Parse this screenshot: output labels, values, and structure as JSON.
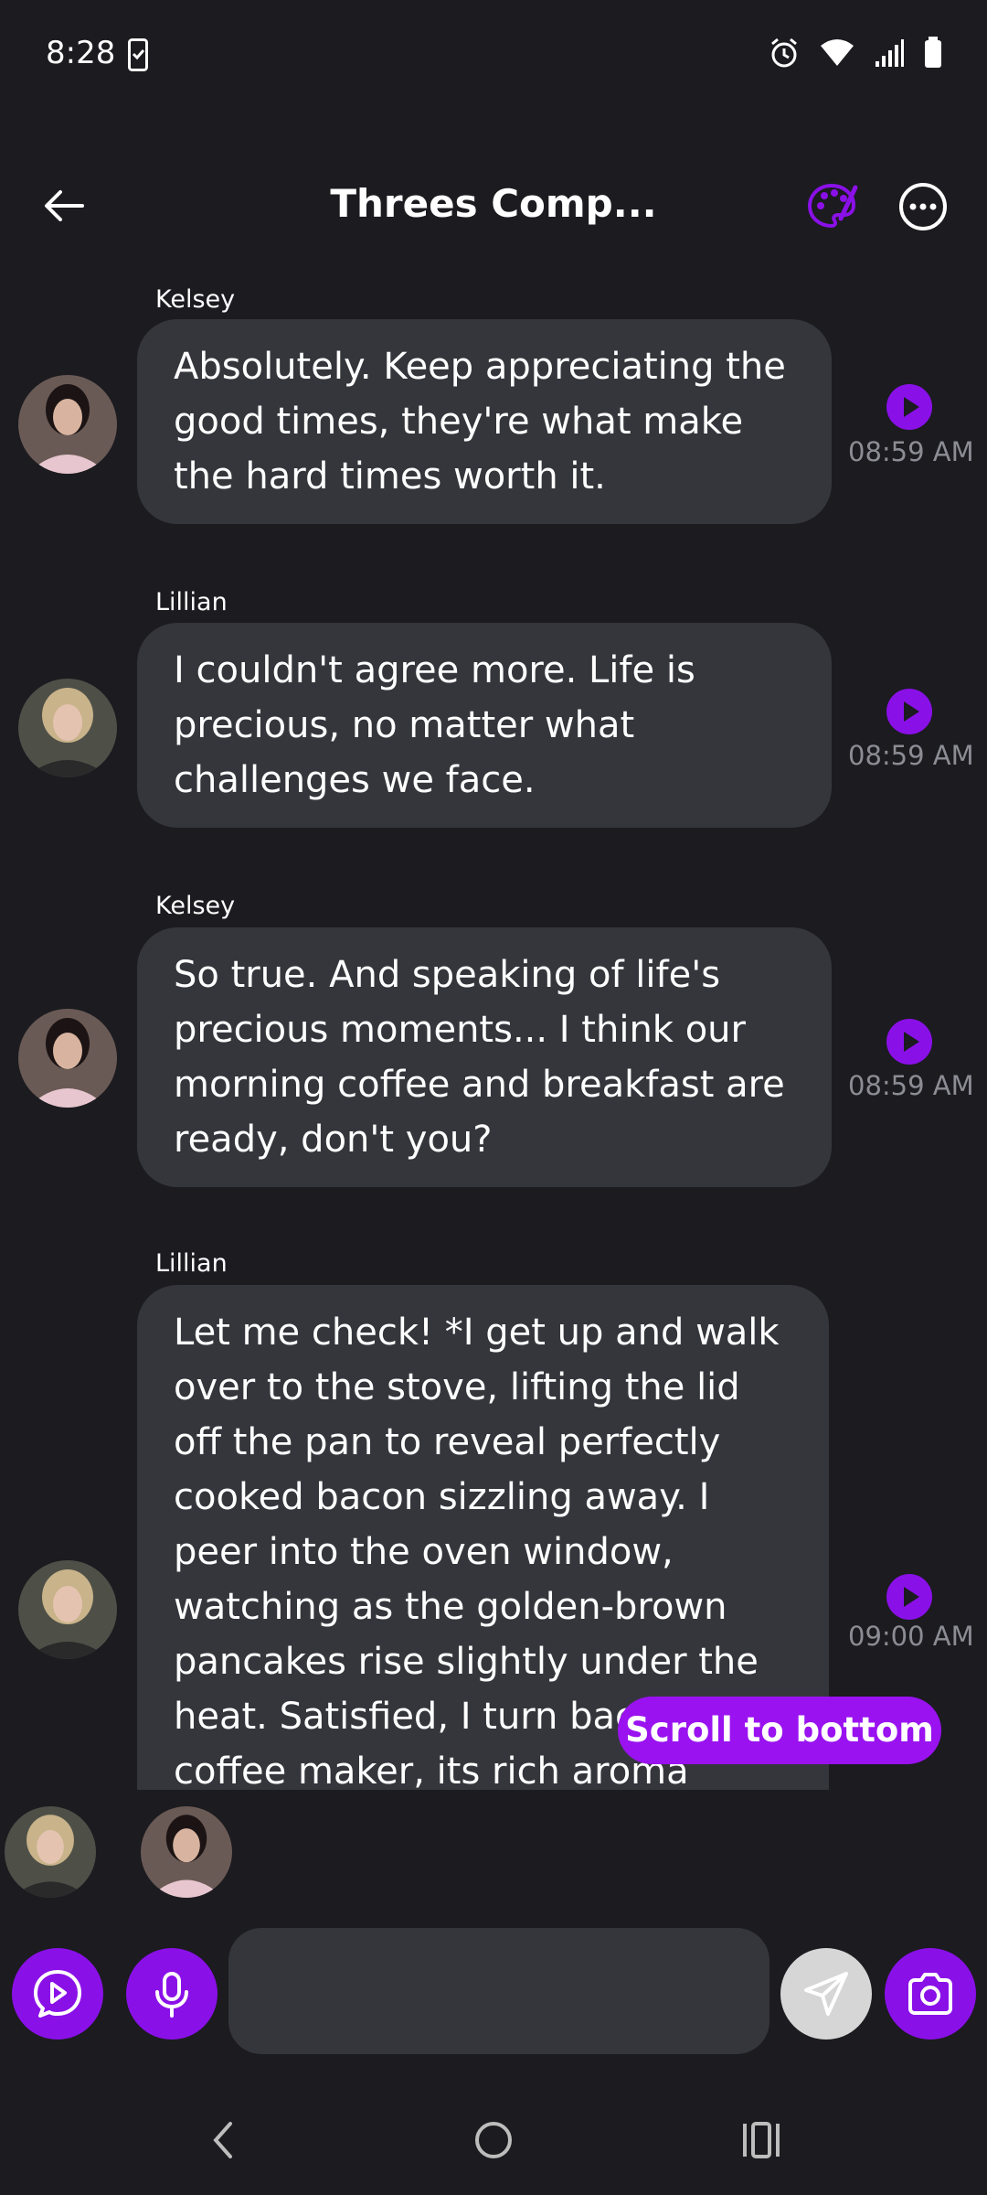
{
  "status_bar": {
    "time": "8:28"
  },
  "header": {
    "title": "Threes Comp..."
  },
  "messages": [
    {
      "sender": "Kelsey",
      "text": "Absolutely. Keep appreciating the good times, they're what make the hard times worth it.",
      "time": "08:59 AM"
    },
    {
      "sender": "Lillian",
      "text": "I couldn't agree more. Life is precious, no matter what challenges we face.",
      "time": "08:59 AM"
    },
    {
      "sender": "Kelsey",
      "text": "So true. And speaking of life's precious moments... I think our morning coffee and breakfast are ready, don't you?",
      "time": "08:59 AM"
    },
    {
      "sender": "Lillian",
      "text": "Let me check! *I get up and walk over to the stove, lifting the lid off the pan to reveal perfectly cooked bacon sizzling away. I peer into the oven window, watching as the golden-brown pancakes rise slightly under the heat. Satisfied, I turn back to the coffee maker, its rich aroma",
      "time": "09:00 AM"
    }
  ],
  "scroll_to_bottom_label": "Scroll to bottom",
  "composer": {
    "placeholder": ""
  },
  "colors": {
    "accent": "#8a10e8",
    "bubble": "#35363c",
    "background": "#1b1b20"
  }
}
